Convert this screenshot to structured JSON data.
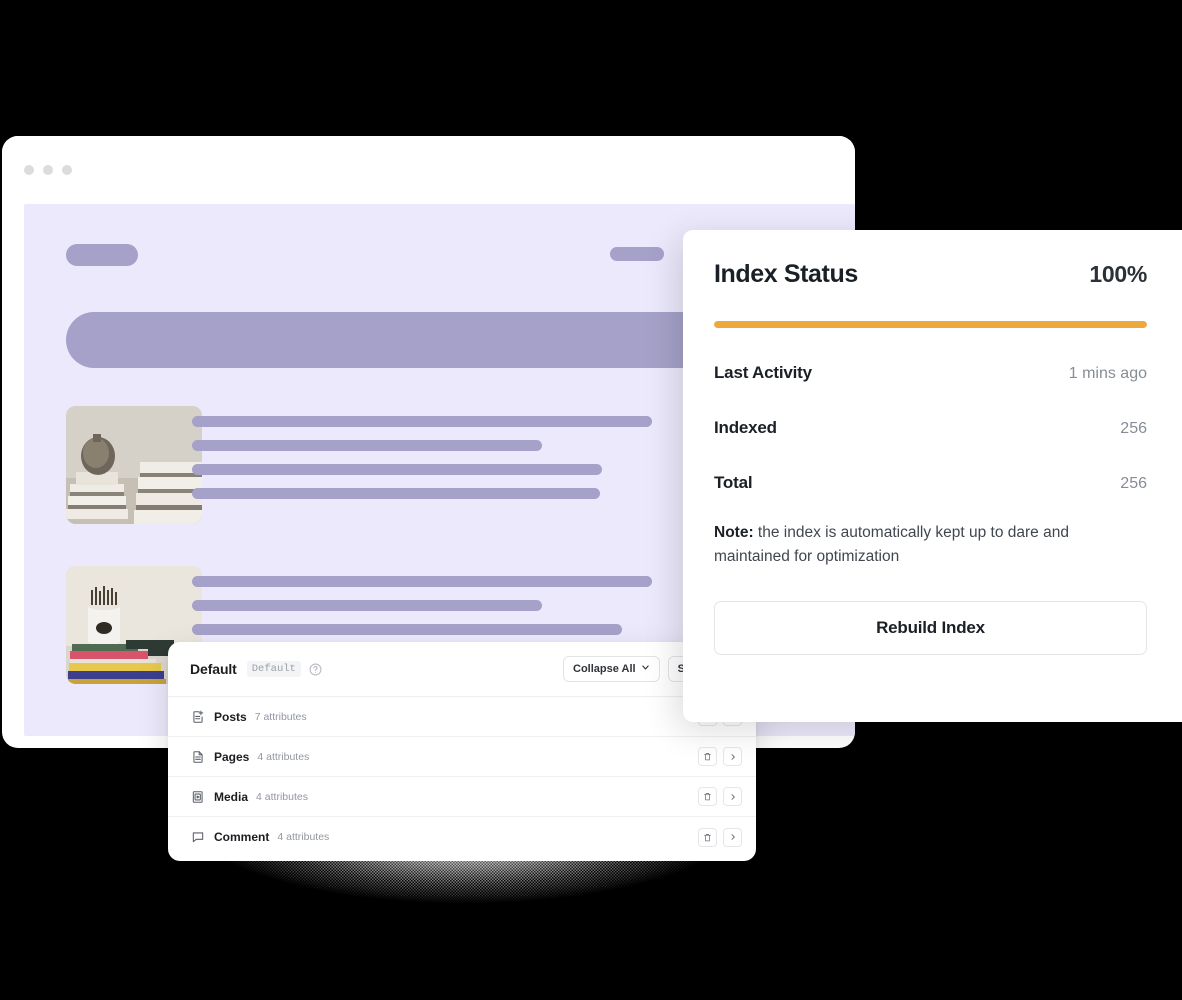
{
  "browser_mock": {
    "window_dots": [
      "dot-1",
      "dot-2",
      "dot-3"
    ],
    "thumbnails": [
      {
        "alt": "textured ceramic vase resting on stacked white books"
      },
      {
        "alt": "pencil cup on a stack of colorful books"
      }
    ]
  },
  "schema_card": {
    "title": "Default",
    "badge": "Default",
    "help_icon": "help-circle-icon",
    "buttons": {
      "collapse_all": "Collapse All",
      "collapse_chevron": "chevron-down-icon",
      "sources": "Sources &"
    },
    "rows": [
      {
        "icon": "document-plus-icon",
        "name": "Posts",
        "attributes": "7 attributes",
        "delete_icon": "trash-icon",
        "open_icon": "chevron-right-icon"
      },
      {
        "icon": "document-icon",
        "name": "Pages",
        "attributes": "4 attributes",
        "delete_icon": "trash-icon",
        "open_icon": "chevron-right-icon"
      },
      {
        "icon": "media-icon",
        "name": "Media",
        "attributes": "4 attributes",
        "delete_icon": "trash-icon",
        "open_icon": "chevron-right-icon"
      },
      {
        "icon": "comment-icon",
        "name": "Comment",
        "attributes": "4 attributes",
        "delete_icon": "trash-icon",
        "open_icon": "chevron-right-icon"
      }
    ]
  },
  "index_panel": {
    "title": "Index Status",
    "percent": "100%",
    "progress_value": 100,
    "progress_color": "#EDA93C",
    "stats": [
      {
        "label": "Last Activity",
        "value": "1 mins ago"
      },
      {
        "label": "Indexed",
        "value": "256"
      },
      {
        "label": "Total",
        "value": "256"
      }
    ],
    "note_label": "Note:",
    "note_text": " the index is automatically kept up to dare and maintained for optimization",
    "rebuild_button": "Rebuild Index"
  },
  "colors": {
    "accent_orange": "#EDA93C",
    "mock_lavender_bg": "#EBE9FB",
    "mock_bar": "#A5A1C9",
    "page_background": "#000000"
  }
}
